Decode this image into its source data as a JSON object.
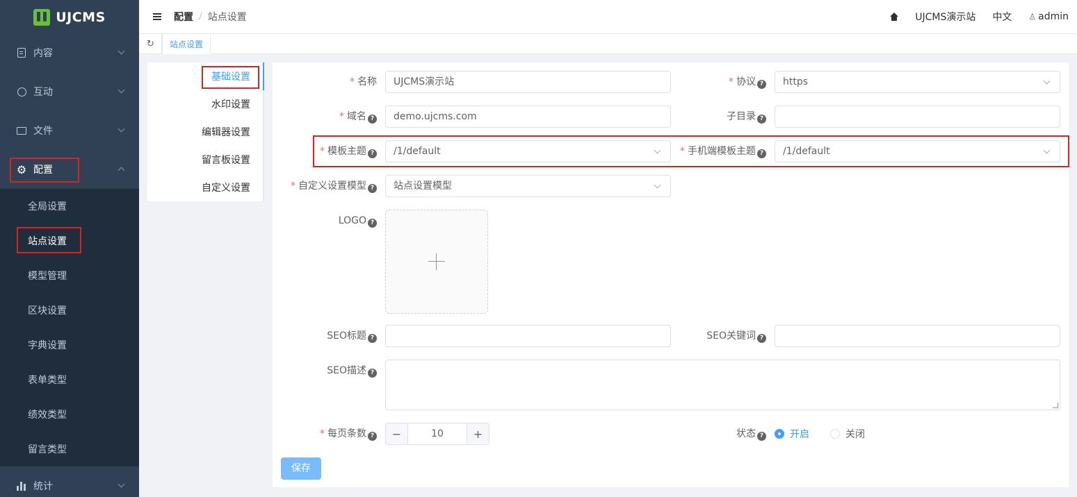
{
  "app": {
    "logo_text": "UJCMS"
  },
  "sidebar": {
    "menu": [
      {
        "label": "内容",
        "icon": "document-icon"
      },
      {
        "label": "互动",
        "icon": "chat-icon"
      },
      {
        "label": "文件",
        "icon": "folder-icon"
      },
      {
        "label": "配置",
        "icon": "gear-icon"
      },
      {
        "label": "统计",
        "icon": "bar-chart-icon"
      }
    ],
    "config_sub": [
      "全局设置",
      "站点设置",
      "模型管理",
      "区块设置",
      "字典设置",
      "表单类型",
      "绩效类型",
      "留言类型"
    ]
  },
  "header": {
    "breadcrumb": {
      "parent": "配置",
      "separator": "/",
      "current": "站点设置"
    },
    "site_name": "UJCMS演示站",
    "language": "中文",
    "user": "admin"
  },
  "tags": {
    "active_tag": "站点设置"
  },
  "settings_nav": [
    "基础设置",
    "水印设置",
    "编辑器设置",
    "留言板设置",
    "自定义设置"
  ],
  "form": {
    "name_label": "名称",
    "name_value": "UJCMS演示站",
    "protocol_label": "协议",
    "protocol_value": "https",
    "domain_label": "域名",
    "domain_value": "demo.ujcms.com",
    "subdir_label": "子目录",
    "subdir_value": "",
    "theme_label": "模板主题",
    "theme_value": "/1/default",
    "mobile_theme_label": "手机端模板主题",
    "mobile_theme_value": "/1/default",
    "custom_model_label": "自定义设置模型",
    "custom_model_value": "站点设置模型",
    "logo_label": "LOGO",
    "seo_title_label": "SEO标题",
    "seo_keywords_label": "SEO关键词",
    "seo_desc_label": "SEO描述",
    "page_size_label": "每页条数",
    "page_size_value": "10",
    "status_label": "状态",
    "status_on": "开启",
    "status_off": "关闭",
    "required_mark": "*",
    "help_mark": "?",
    "save_label": "保存"
  },
  "colors": {
    "sidebar_bg": "#304156",
    "primary": "#409eff",
    "required": "#f56c6c",
    "highlight_box": "#e02020"
  }
}
